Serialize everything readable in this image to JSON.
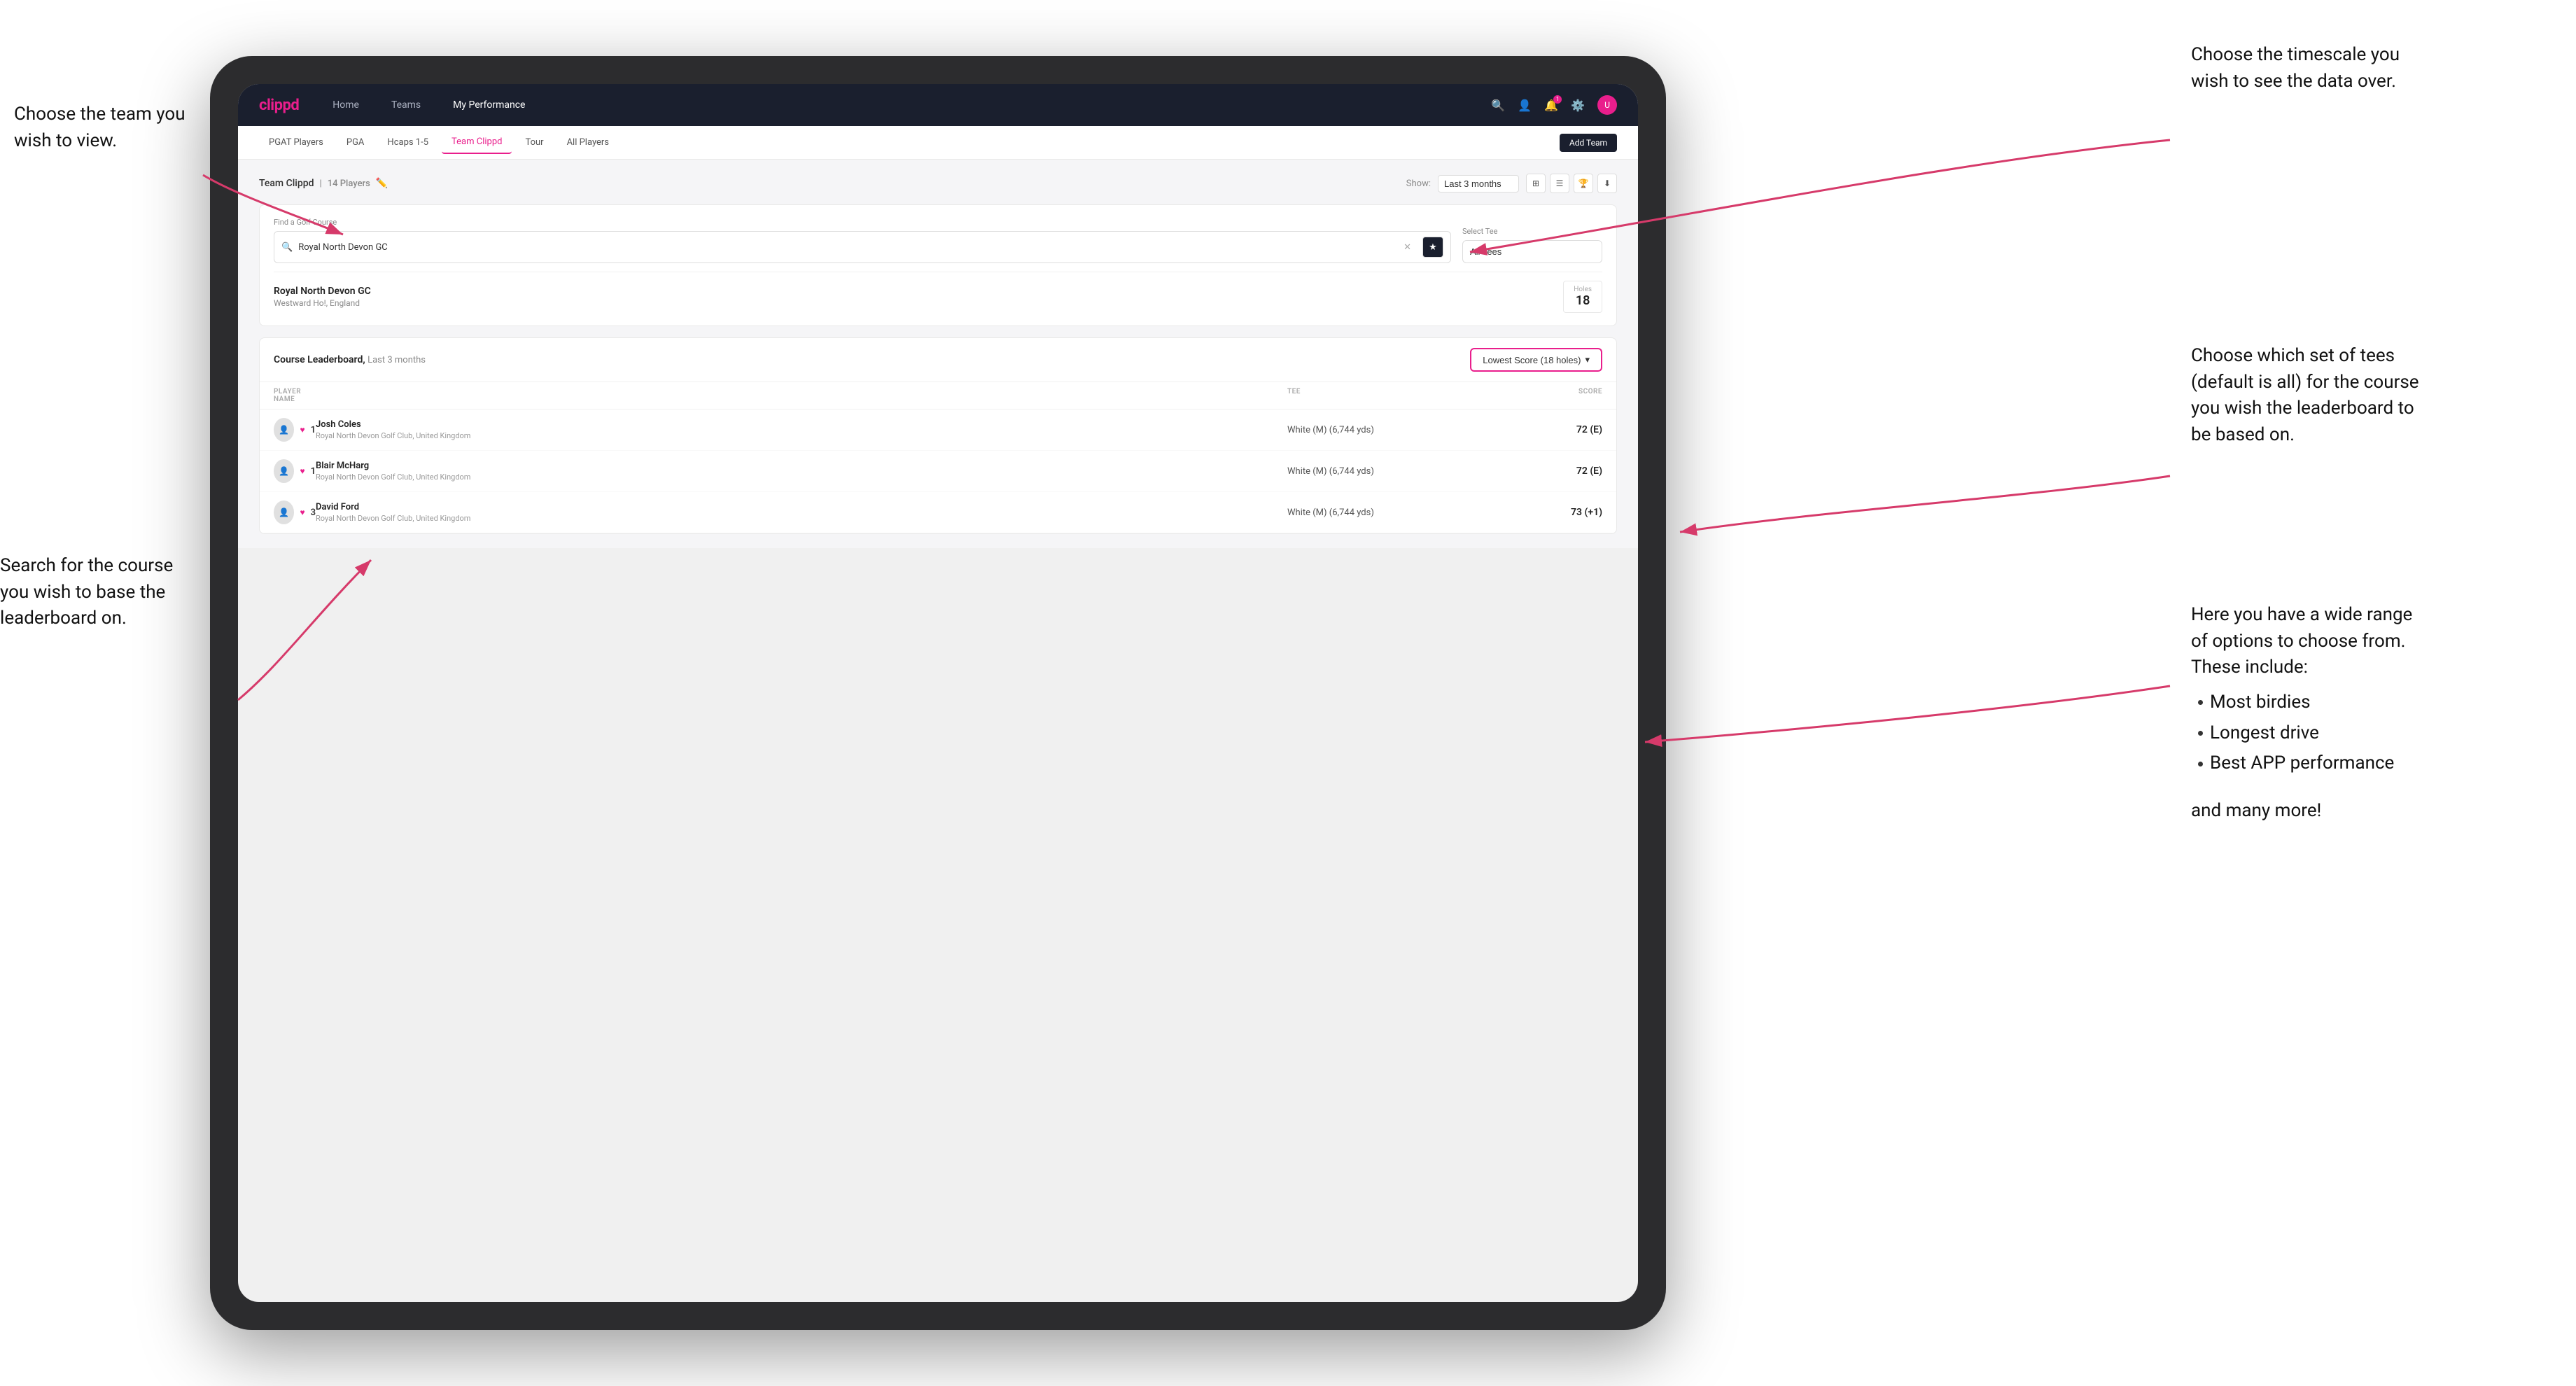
{
  "annotations": {
    "left_1_title": "Choose the team you",
    "left_1_line2": "wish to view.",
    "left_2_title": "Search for the course",
    "left_2_line2": "you wish to base the",
    "left_2_line3": "leaderboard on.",
    "right_1_title": "Choose the timescale you",
    "right_1_line2": "wish to see the data over.",
    "right_2_title": "Choose which set of tees",
    "right_2_line2": "(default is all) for the course",
    "right_2_line3": "you wish the leaderboard to",
    "right_2_line4": "be based on.",
    "right_3_title": "Here you have a wide range",
    "right_3_line2": "of options to choose from.",
    "right_3_line3": "These include:",
    "bullet_1": "Most birdies",
    "bullet_2": "Longest drive",
    "bullet_3": "Best APP performance",
    "and_more": "and many more!"
  },
  "navbar": {
    "logo": "clippd",
    "links": [
      "Home",
      "Teams",
      "My Performance"
    ],
    "active_link": "My Performance"
  },
  "sub_nav": {
    "items": [
      "PGAT Players",
      "PGA",
      "Hcaps 1-5",
      "Team Clippd",
      "Tour",
      "All Players"
    ],
    "active_item": "Team Clippd",
    "add_team_label": "Add Team"
  },
  "team_header": {
    "title": "Team Clippd",
    "player_count": "14 Players",
    "show_label": "Show:",
    "show_value": "Last 3 months"
  },
  "search_section": {
    "find_course_label": "Find a Golf Course",
    "course_value": "Royal North Devon GC",
    "select_tee_label": "Select Tee",
    "tee_value": "All Tees"
  },
  "course_result": {
    "name": "Royal North Devon GC",
    "location": "Westward Ho!, England",
    "holes_label": "Holes",
    "holes_value": "18"
  },
  "leaderboard": {
    "title": "Course Leaderboard,",
    "period": "Last 3 months",
    "score_type": "Lowest Score (18 holes)",
    "columns": {
      "player_name": "PLAYER NAME",
      "tee": "TEE",
      "score": "SCORE"
    },
    "rows": [
      {
        "rank": "1",
        "name": "Josh Coles",
        "club": "Royal North Devon Golf Club, United Kingdom",
        "tee": "White (M) (6,744 yds)",
        "score": "72 (E)"
      },
      {
        "rank": "1",
        "name": "Blair McHarg",
        "club": "Royal North Devon Golf Club, United Kingdom",
        "tee": "White (M) (6,744 yds)",
        "score": "72 (E)"
      },
      {
        "rank": "3",
        "name": "David Ford",
        "club": "Royal North Devon Golf Club, United Kingdom",
        "tee": "White (M) (6,744 yds)",
        "score": "73 (+1)"
      }
    ]
  }
}
